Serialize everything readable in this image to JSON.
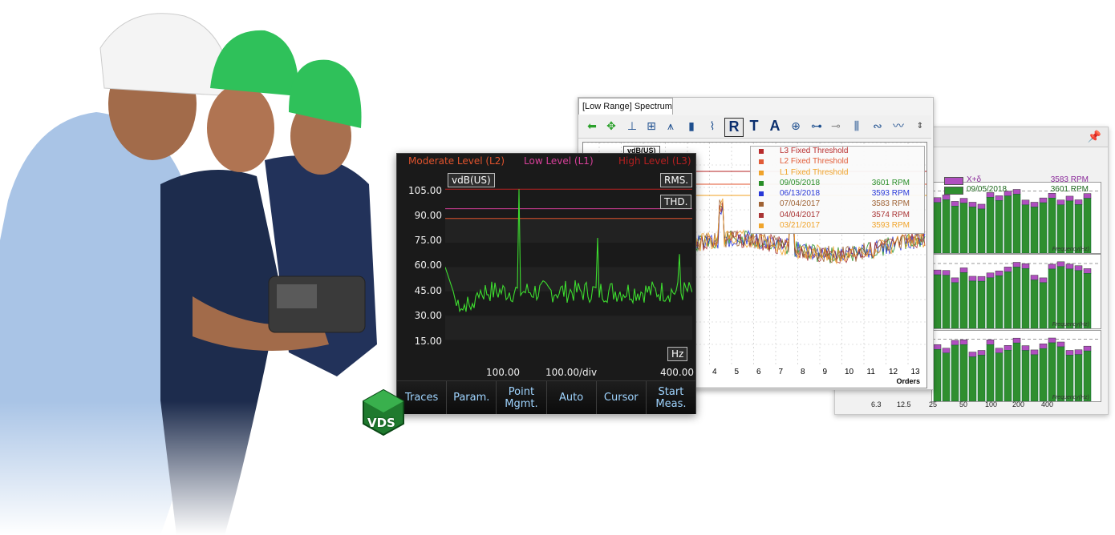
{
  "device": {
    "legend": [
      {
        "label": "Moderate Level (L2)",
        "color": "#e0532d"
      },
      {
        "label": "Low Level (L1)",
        "color": "#d8409a"
      },
      {
        "label": "High Level (L3)",
        "color": "#b52020"
      }
    ],
    "unit_chip": "vdB(US)",
    "rms_chip": "RMS.",
    "thd_chip": "THD.",
    "hz_chip": "Hz",
    "y_ticks": [
      "105.00",
      "90.00",
      "75.00",
      "60.00",
      "45.00",
      "30.00",
      "15.00"
    ],
    "x_start": "100.00",
    "x_div": "100.00/div",
    "x_end": "400.00",
    "menu": [
      "Traces",
      "Param.",
      "Point\nMgmt.",
      "Auto",
      "Cursor",
      "Start\nMeas."
    ],
    "trace_color": "#3ddc2f"
  },
  "logo": {
    "text": "VDS"
  },
  "spectrum_window": {
    "tab_title": "[Low Range] Spectrum",
    "toolbar_icons": [
      "back-arrow-icon",
      "move-icon",
      "cursor-single-icon",
      "cursor-double-icon",
      "peak-icon",
      "bar-chart-icon",
      "probe-icon",
      "R",
      "T",
      "A",
      "target-icon",
      "zoom-icon",
      "zoom-out-icon",
      "harmonics-icon",
      "sidebands-icon",
      "waveform-icon"
    ],
    "y_unit": "vdB(US)",
    "legend": [
      {
        "label": "L3 Fixed Threshold",
        "rpm": "",
        "color": "#b52020"
      },
      {
        "label": "L2 Fixed Threshold",
        "rpm": "",
        "color": "#e0532d"
      },
      {
        "label": "L1 Fixed Threshold",
        "rpm": "",
        "color": "#f0a020"
      },
      {
        "label": "09/05/2018",
        "rpm": "3601 RPM",
        "color": "#1e8a1e"
      },
      {
        "label": "06/13/2018",
        "rpm": "3593 RPM",
        "color": "#1d2ed8"
      },
      {
        "label": "07/04/2017",
        "rpm": "3583 RPM",
        "color": "#9a5a2a"
      },
      {
        "label": "04/04/2017",
        "rpm": "3574 RPM",
        "color": "#a52a2a"
      },
      {
        "label": "03/21/2017",
        "rpm": "3593 RPM",
        "color": "#f0a020"
      }
    ],
    "x_ticks": [
      "4",
      "5",
      "6",
      "7",
      "8",
      "9",
      "10",
      "11",
      "12",
      "13"
    ],
    "x_label": "Orders"
  },
  "bar_window": {
    "legend": [
      {
        "label": "X+δ",
        "rpm": "3583 RPM",
        "color": "#b04fc0"
      },
      {
        "label": "09/05/2018",
        "rpm": "3601 RPM",
        "color": "#2f8f2f"
      }
    ],
    "panel_label": "Frequency(Hz)",
    "x_ticks": [
      "6.3",
      "12.5",
      "25",
      "50",
      "100",
      "200",
      "400"
    ]
  }
}
